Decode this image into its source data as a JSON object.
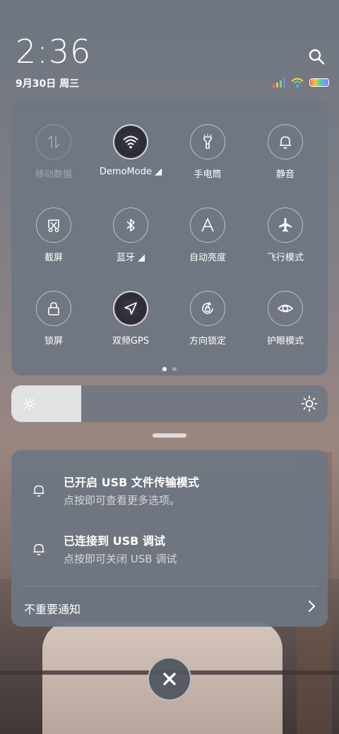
{
  "status_bar": {
    "time": "2:36",
    "date": "9月30日 周三"
  },
  "quick_settings": {
    "tiles": [
      {
        "label": "移动数据",
        "icon": "mobile-data-icon",
        "state": "disabled"
      },
      {
        "label": "DemoMode ◢",
        "icon": "wifi-icon",
        "state": "active"
      },
      {
        "label": "手电筒",
        "icon": "flashlight-icon",
        "state": "off"
      },
      {
        "label": "静音",
        "icon": "bell-icon",
        "state": "off"
      },
      {
        "label": "截屏",
        "icon": "screenshot-icon",
        "state": "off"
      },
      {
        "label": "蓝牙 ◢",
        "icon": "bluetooth-icon",
        "state": "off"
      },
      {
        "label": "自动亮度",
        "icon": "auto-brightness-icon",
        "state": "off"
      },
      {
        "label": "飞行模式",
        "icon": "airplane-icon",
        "state": "off"
      },
      {
        "label": "锁屏",
        "icon": "lock-icon",
        "state": "off"
      },
      {
        "label": "双频GPS",
        "icon": "location-icon",
        "state": "active"
      },
      {
        "label": "方向锁定",
        "icon": "rotation-lock-icon",
        "state": "off"
      },
      {
        "label": "护眼模式",
        "icon": "eye-icon",
        "state": "off"
      }
    ],
    "page_count": 2,
    "current_page": 1
  },
  "brightness": {
    "level": 0.22
  },
  "notifications": {
    "items": [
      {
        "title": "已开启 USB 文件传输模式",
        "subtitle": "点按即可查看更多选项。",
        "icon": "notification-bell-icon"
      },
      {
        "title": "已连接到 USB 调试",
        "subtitle": "点按即可关闭 USB 调试",
        "icon": "notification-bell-icon"
      }
    ],
    "less_important_label": "不重要通知"
  },
  "colors": {
    "panel": "#6e7682",
    "accent_active": "#2c2c36"
  }
}
